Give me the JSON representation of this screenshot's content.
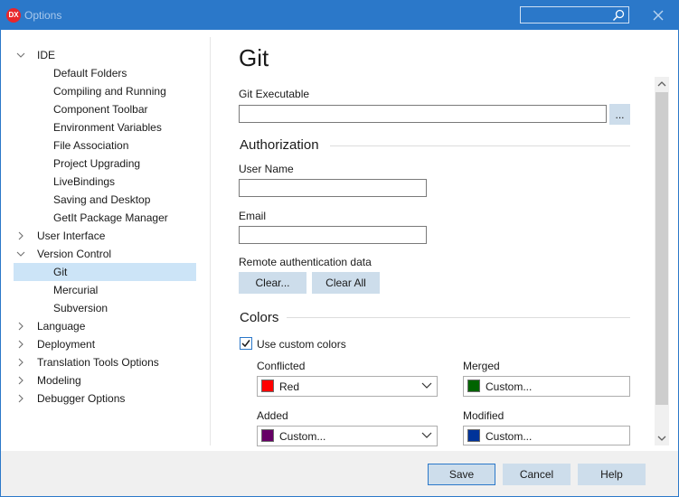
{
  "window": {
    "app_icon_text": "DX",
    "title": "Options",
    "search_placeholder": ""
  },
  "tree": {
    "items": [
      {
        "label": "IDE",
        "level": 0,
        "expanded": true
      },
      {
        "label": "Default Folders",
        "level": 1
      },
      {
        "label": "Compiling and Running",
        "level": 1
      },
      {
        "label": "Component Toolbar",
        "level": 1
      },
      {
        "label": "Environment Variables",
        "level": 1
      },
      {
        "label": "File Association",
        "level": 1
      },
      {
        "label": "Project Upgrading",
        "level": 1
      },
      {
        "label": "LiveBindings",
        "level": 1
      },
      {
        "label": "Saving and Desktop",
        "level": 1
      },
      {
        "label": "GetIt Package Manager",
        "level": 1
      },
      {
        "label": "User Interface",
        "level": 0,
        "expanded": false
      },
      {
        "label": "Version Control",
        "level": 0,
        "expanded": true
      },
      {
        "label": "Git",
        "level": 1,
        "selected": true
      },
      {
        "label": "Mercurial",
        "level": 1
      },
      {
        "label": "Subversion",
        "level": 1
      },
      {
        "label": "Language",
        "level": 0,
        "expanded": false
      },
      {
        "label": "Deployment",
        "level": 0,
        "expanded": false
      },
      {
        "label": "Translation Tools Options",
        "level": 0,
        "expanded": false
      },
      {
        "label": "Modeling",
        "level": 0,
        "expanded": false
      },
      {
        "label": "Debugger Options",
        "level": 0,
        "expanded": false
      }
    ]
  },
  "page": {
    "title": "Git",
    "git_executable_label": "Git Executable",
    "git_executable_value": "",
    "browse_label": "...",
    "authorization": {
      "heading": "Authorization",
      "user_name_label": "User Name",
      "user_name_value": "",
      "email_label": "Email",
      "email_value": "",
      "remote_auth_label": "Remote authentication data",
      "clear_label": "Clear...",
      "clear_all_label": "Clear All"
    },
    "colors": {
      "heading": "Colors",
      "use_custom_label": "Use custom colors",
      "use_custom_checked": true,
      "fields": [
        {
          "label": "Conflicted",
          "value": "Red",
          "color": "#ff0000"
        },
        {
          "label": "Merged",
          "value": "Custom...",
          "color": "#006400"
        },
        {
          "label": "Added",
          "value": "Custom...",
          "color": "#660066"
        },
        {
          "label": "Modified",
          "value": "Custom...",
          "color": "#003399"
        }
      ]
    }
  },
  "footer": {
    "save_label": "Save",
    "cancel_label": "Cancel",
    "help_label": "Help"
  },
  "colors": {
    "titlebar": "#2b78c9",
    "selection": "#cce4f7",
    "button": "#cdddeb"
  }
}
